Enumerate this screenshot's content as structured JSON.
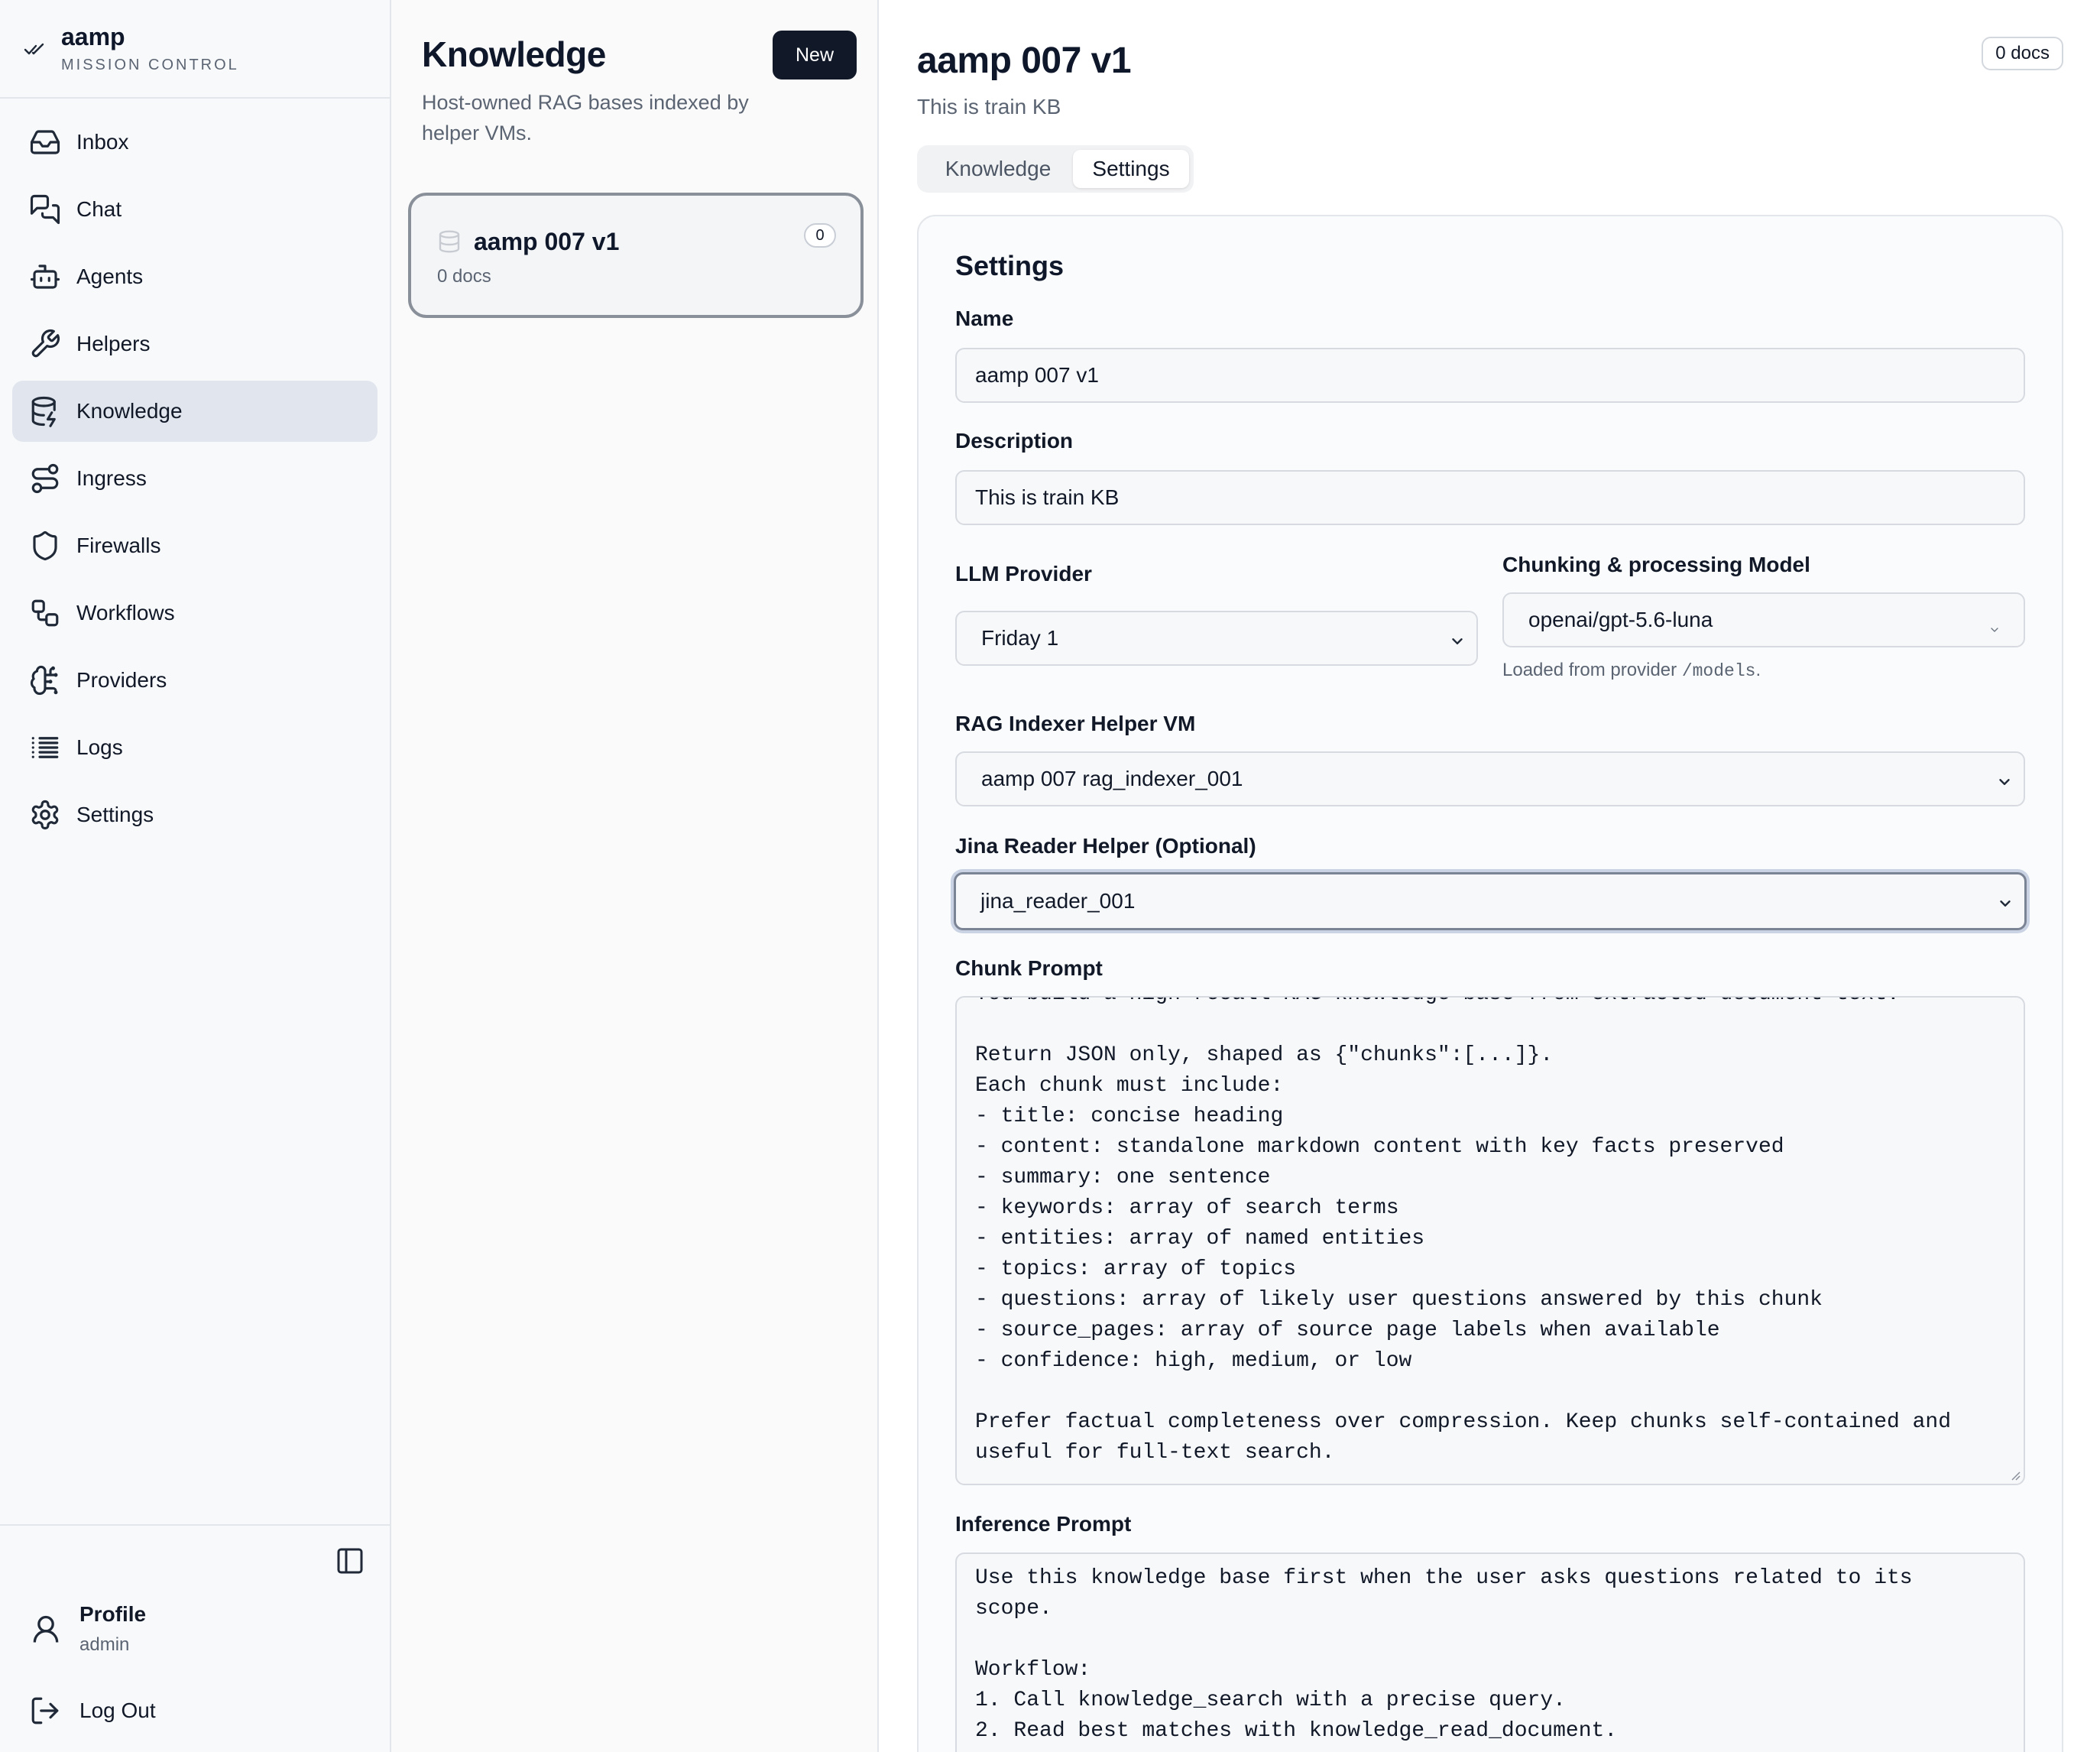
{
  "brand": {
    "name": "aamp",
    "subtitle": "MISSION CONTROL"
  },
  "sidebar": {
    "items": [
      {
        "label": "Inbox",
        "icon": "inbox-icon",
        "active": false
      },
      {
        "label": "Chat",
        "icon": "chat-icon",
        "active": false
      },
      {
        "label": "Agents",
        "icon": "bot-icon",
        "active": false
      },
      {
        "label": "Helpers",
        "icon": "wrench-icon",
        "active": false
      },
      {
        "label": "Knowledge",
        "icon": "database-icon",
        "active": true
      },
      {
        "label": "Ingress",
        "icon": "route-icon",
        "active": false
      },
      {
        "label": "Firewalls",
        "icon": "shield-icon",
        "active": false
      },
      {
        "label": "Workflows",
        "icon": "workflow-icon",
        "active": false
      },
      {
        "label": "Providers",
        "icon": "brain-icon",
        "active": false
      },
      {
        "label": "Logs",
        "icon": "list-icon",
        "active": false
      },
      {
        "label": "Settings",
        "icon": "gear-icon",
        "active": false
      }
    ],
    "profile": {
      "name": "Profile",
      "role": "admin"
    },
    "logout_label": "Log Out"
  },
  "knowledge_list": {
    "title": "Knowledge",
    "description": "Host-owned RAG bases indexed by helper VMs.",
    "new_label": "New",
    "cards": [
      {
        "name": "aamp 007 v1",
        "docs": "0 docs",
        "count": "0"
      }
    ]
  },
  "detail": {
    "title": "aamp 007 v1",
    "description": "This is train KB",
    "docs_badge": "0 docs",
    "tabs": [
      {
        "label": "Knowledge",
        "active": false
      },
      {
        "label": "Settings",
        "active": true
      }
    ],
    "settings": {
      "heading": "Settings",
      "name_label": "Name",
      "name_value": "aamp 007 v1",
      "description_label": "Description",
      "description_value": "This is train KB",
      "provider_label": "LLM Provider",
      "provider_value": "Friday 1",
      "model_label": "Chunking & processing Model",
      "model_value": "openai/gpt-5.6-luna",
      "model_hint_prefix": "Loaded from provider",
      "model_hint_code": "/models",
      "model_hint_suffix": ".",
      "indexer_label": "RAG Indexer Helper VM",
      "indexer_value": "aamp 007 rag_indexer_001",
      "jina_label": "Jina Reader Helper (Optional)",
      "jina_value": "jina_reader_001",
      "chunk_prompt_label": "Chunk Prompt",
      "chunk_prompt": "You build a high-recall RAG knowledge base from extracted document text.\n\nReturn JSON only, shaped as {\"chunks\":[...]}.\nEach chunk must include:\n- title: concise heading\n- content: standalone markdown content with key facts preserved\n- summary: one sentence\n- keywords: array of search terms\n- entities: array of named entities\n- topics: array of topics\n- questions: array of likely user questions answered by this chunk\n- source_pages: array of source page labels when available\n- confidence: high, medium, or low\n\nPrefer factual completeness over compression. Keep chunks self-contained and\nuseful for full-text search.",
      "inference_prompt_label": "Inference Prompt",
      "inference_prompt": "Use this knowledge base first when the user asks questions related to its\nscope.\n\nWorkflow:\n1. Call knowledge_search with a precise query.\n2. Read best matches with knowledge_read_document."
    }
  }
}
